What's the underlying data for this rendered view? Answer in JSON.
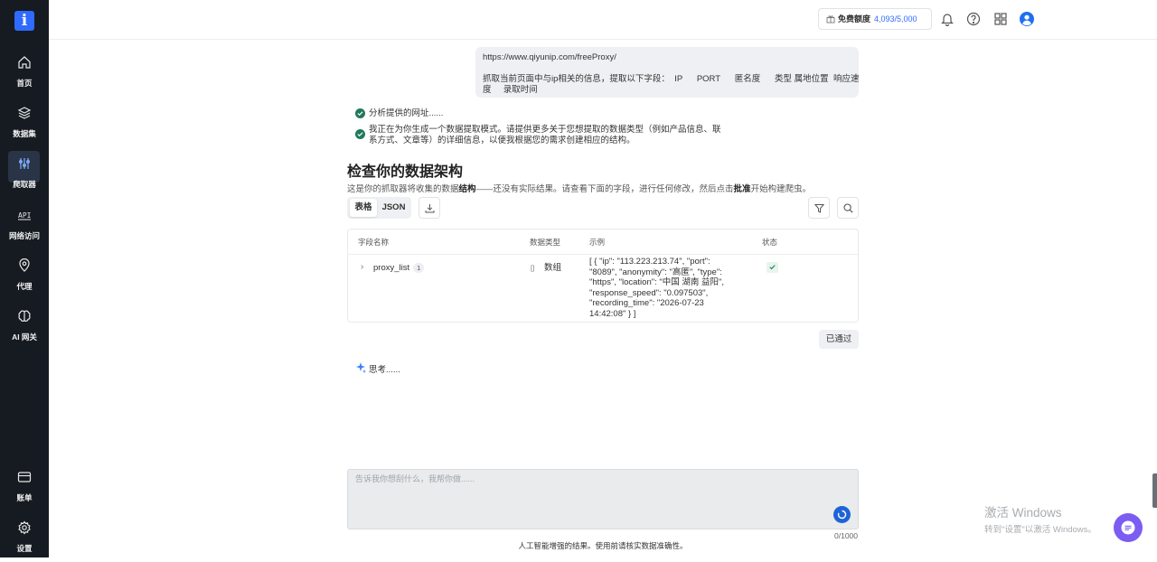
{
  "sidebar": {
    "logo": "i",
    "items": [
      {
        "label": "首页",
        "icon": "home-icon"
      },
      {
        "label": "数据集",
        "icon": "database-icon"
      },
      {
        "label": "爬取器",
        "icon": "crawler-icon",
        "active": true
      },
      {
        "label": "网络访问",
        "icon": "api-icon"
      },
      {
        "label": "代理",
        "icon": "location-pin-icon"
      },
      {
        "label": "AI 网关",
        "icon": "brain-icon"
      }
    ],
    "bottom_items": [
      {
        "label": "账单",
        "icon": "card-icon"
      },
      {
        "label": "设置",
        "icon": "gear-icon"
      }
    ]
  },
  "header": {
    "quota_label": "免费额度",
    "quota_value": "4,093/5,000",
    "icons": [
      "bell-icon",
      "help-icon",
      "apps-grid-icon",
      "user-avatar-icon"
    ]
  },
  "conversation": {
    "user_url": "https://www.qiyunip.com/freeProxy/",
    "user_instruction_line1": "抓取当前页面中与ip相关的信息，提取以下字段：  IP      PORT      匿名度      类型 属地位置  响应速",
    "user_instruction_line2": "度     录取时间",
    "step1": "分析提供的网址......",
    "step2_line1": "我正在为你生成一个数据提取模式。请提供更多关于您想提取的数据类型（例如产品信息、联",
    "step2_line2": "系方式、文章等）的详细信息，以便我根据您的需求创建相应的结构。"
  },
  "schema": {
    "title": "检查你的数据架构",
    "desc_part1": "这是你的抓取器将收集的数据",
    "desc_bold1": "结构",
    "desc_part2": "——还没有实际结果。请查看下面的字段，进行任何修改，然后点击",
    "desc_bold2": "批准",
    "desc_part3": "开始构建爬虫。",
    "view_tabs": [
      "表格",
      "JSON"
    ],
    "columns": [
      "字段名称",
      "数据类型",
      "示例",
      "状态"
    ],
    "rows": [
      {
        "field": "proxy_list",
        "count": "1",
        "type_symbol": "[]",
        "type": "数组",
        "example_lines": [
          "[ { \"ip\": \"113.223.213.74\", \"port\":",
          "\"8089\", \"anonymity\": \"高匿\", \"type\":",
          "\"https\", \"location\": \"中国 湖南 益阳\",",
          "\"response_speed\": \"0.097503\",",
          "\"recording_time\": \"2026-07-23",
          "14:42:08\" } ]"
        ],
        "status": "approved"
      }
    ],
    "passed_label": "已通过"
  },
  "thinking": "思考......",
  "input": {
    "placeholder": "告诉我你想刮什么，我帮你做......",
    "char_count": "0/1000"
  },
  "disclaimer": "人工智能增强的结果。使用前请核实数据准确性。",
  "os_watermark": {
    "line1": "激活 Windows",
    "line2": "转到\"设置\"以激活 Windows。"
  },
  "colors": {
    "sidebar_bg": "#161b22",
    "accent_blue": "#2f6bff",
    "success_green": "#1f7a5a",
    "chat_fab": "#7c5cf2"
  }
}
